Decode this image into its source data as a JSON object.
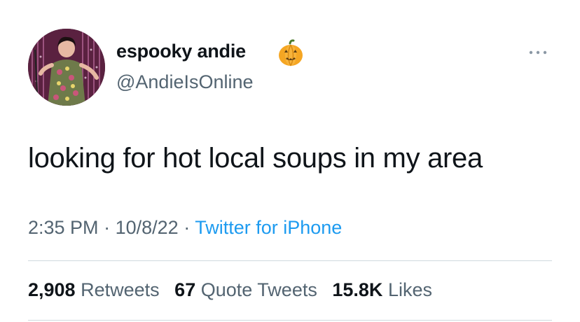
{
  "author": {
    "display_name": "espooky andie",
    "name_emoji": "pumpkin-emoji",
    "handle": "@AndieIsOnline",
    "avatar": "profile-photo"
  },
  "tweet": {
    "text": "looking for hot local soups in my area"
  },
  "meta": {
    "time": "2:35 PM",
    "separator": "·",
    "date": "10/8/22",
    "source": "Twitter for iPhone"
  },
  "stats": {
    "retweets": {
      "count": "2,908",
      "label": "Retweets"
    },
    "quote_tweets": {
      "count": "67",
      "label": "Quote Tweets"
    },
    "likes": {
      "count": "15.8K",
      "label": "Likes"
    }
  },
  "colors": {
    "text": "#0f1419",
    "secondary": "#536471",
    "link": "#1d9bf0",
    "divider": "#cfd9de"
  },
  "more_icon": "more-horizontal-icon"
}
